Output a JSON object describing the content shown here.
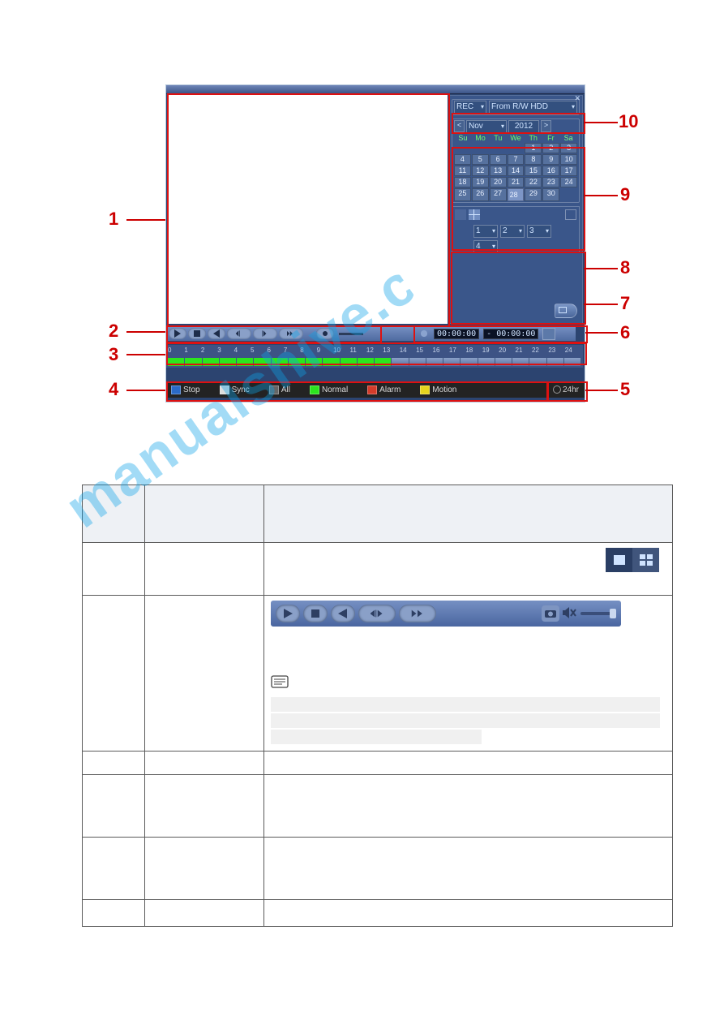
{
  "figure": {
    "source_selector": {
      "mode": "REC",
      "device": "From R/W HDD"
    },
    "calendar_nav": {
      "month": "Nov",
      "year": "2012",
      "prev": "<",
      "next": ">"
    },
    "dow": [
      "Su",
      "Mo",
      "Tu",
      "We",
      "Th",
      "Fr",
      "Sa"
    ],
    "days_leading_empty": 4,
    "day_count": 30,
    "channels": [
      "1",
      "2",
      "3",
      "4"
    ],
    "time_display": {
      "left": "00:00:00",
      "right": "- 00:00:00"
    },
    "timeline_hours": [
      "0",
      "1",
      "2",
      "3",
      "4",
      "5",
      "6",
      "7",
      "8",
      "9",
      "10",
      "11",
      "12",
      "13",
      "14",
      "15",
      "16",
      "17",
      "18",
      "19",
      "20",
      "21",
      "22",
      "23",
      "24"
    ],
    "legend": {
      "stop": "Stop",
      "sync": "Sync",
      "all": "All",
      "normal": "Normal",
      "alarm": "Alarm",
      "motion": "Motion",
      "zoom": "24hr"
    },
    "callouts": {
      "1": "1",
      "2": "2",
      "3": "3",
      "4": "4",
      "5": "5",
      "6": "6",
      "7": "7",
      "8": "8",
      "9": "9",
      "10": "10"
    }
  },
  "watermark": "manualshive.com"
}
